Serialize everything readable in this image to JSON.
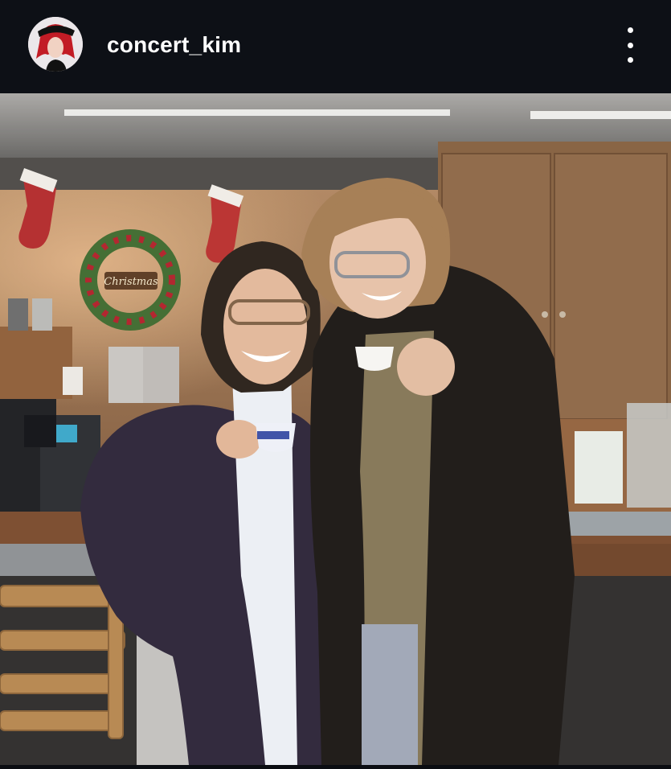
{
  "post": {
    "username": "concert_kim",
    "avatar_icon": "profile-avatar",
    "more_icon": "more-options-icon"
  },
  "photo": {
    "scene": "two-men-holding-coffee-cups-at-cafe-counter",
    "decor_text": "Christmas"
  },
  "colors": {
    "header_bg": "#0d1016",
    "username": "#ffffff"
  }
}
